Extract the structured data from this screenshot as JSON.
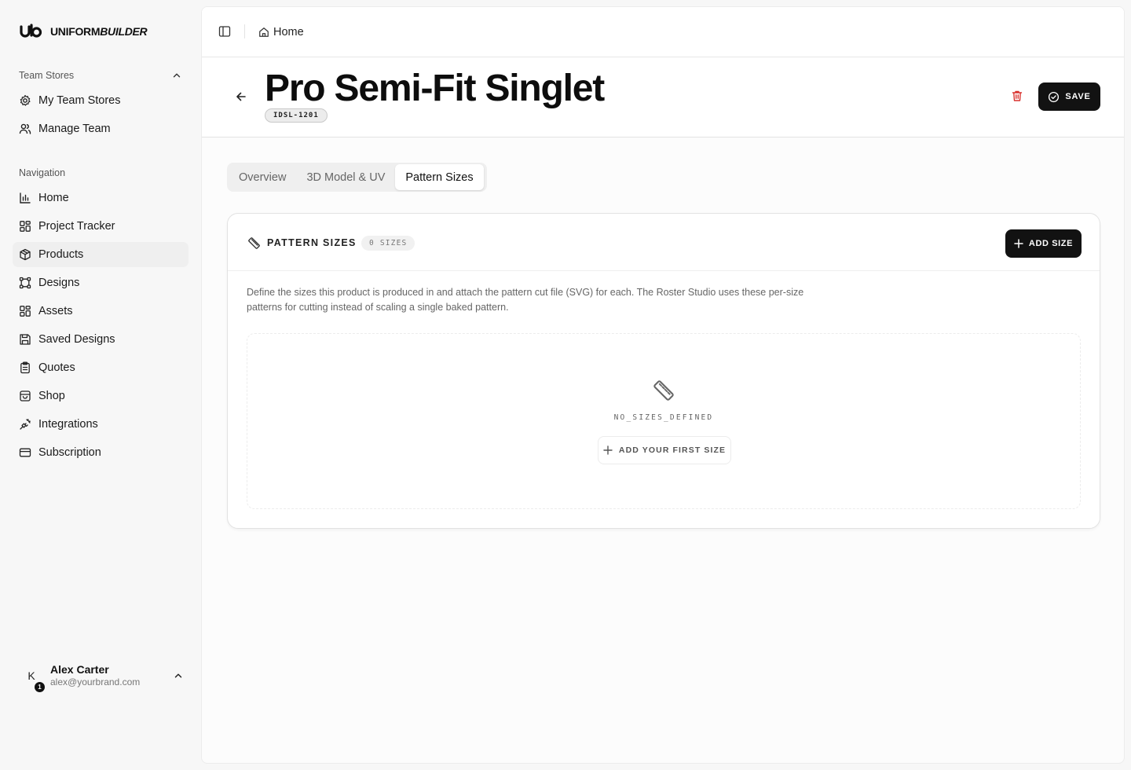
{
  "brand": {
    "logo_mark": "ub",
    "name_part1": "UNIFORM",
    "name_part2": "BUILDER"
  },
  "sidebar": {
    "team_stores": {
      "heading": "Team Stores",
      "items": [
        {
          "label": "My Team Stores",
          "icon": "gear-icon"
        },
        {
          "label": "Manage Team",
          "icon": "users-icon"
        }
      ]
    },
    "navigation": {
      "heading": "Navigation",
      "items": [
        {
          "label": "Home",
          "icon": "bar-chart-icon"
        },
        {
          "label": "Project Tracker",
          "icon": "grid-icon"
        },
        {
          "label": "Products",
          "icon": "box-icon",
          "active": true
        },
        {
          "label": "Designs",
          "icon": "vector-icon"
        },
        {
          "label": "Assets",
          "icon": "grid-icon"
        },
        {
          "label": "Saved Designs",
          "icon": "save-icon"
        },
        {
          "label": "Quotes",
          "icon": "clipboard-icon"
        },
        {
          "label": "Shop",
          "icon": "store-icon"
        },
        {
          "label": "Integrations",
          "icon": "plug-icon"
        },
        {
          "label": "Subscription",
          "icon": "credit-card-icon"
        }
      ]
    },
    "user": {
      "initial": "K",
      "badge": "1",
      "name": "Alex Carter",
      "email": "alex@yourbrand.com"
    }
  },
  "topbar": {
    "breadcrumb": "Home"
  },
  "product": {
    "title": "Pro Semi-Fit Singlet",
    "sku": "IDSL-1201",
    "save_label": "SAVE"
  },
  "tabs": [
    {
      "label": "Overview"
    },
    {
      "label": "3D Model & UV"
    },
    {
      "label": "Pattern Sizes",
      "active": true
    }
  ],
  "pattern_sizes": {
    "title": "PATTERN SIZES",
    "count_label": "0 SIZES",
    "add_button": "ADD SIZE",
    "description": "Define the sizes this product is produced in and attach the pattern cut file (SVG) for each. The Roster Studio uses these per-size patterns for cutting instead of scaling a single baked pattern.",
    "empty_text": "NO_SIZES_DEFINED",
    "add_first_button": "ADD YOUR FIRST SIZE"
  },
  "colors": {
    "accent_dark": "#121212",
    "danger": "#d9322e",
    "sidebar_bg": "#f7f7f7"
  }
}
